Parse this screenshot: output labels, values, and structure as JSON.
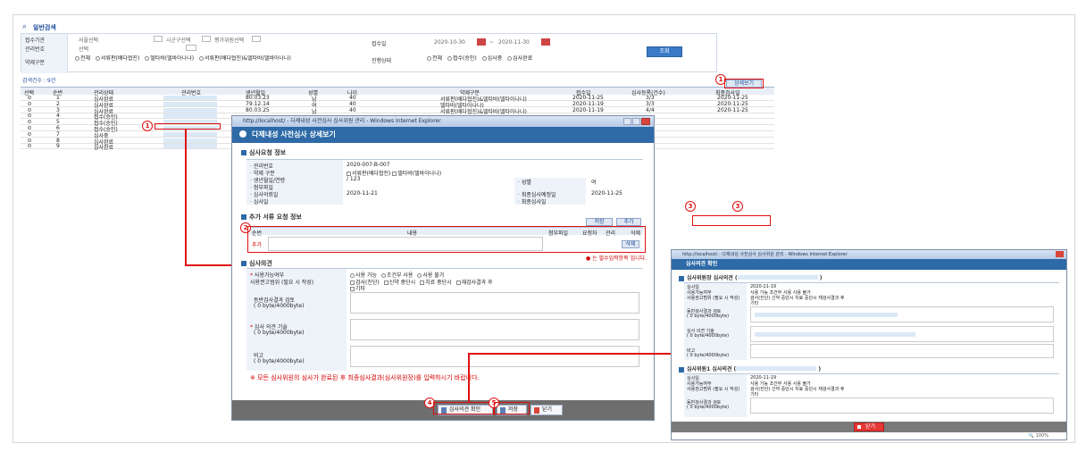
{
  "search": {
    "title": "일반검색",
    "labels": [
      "접수기관",
      "관리번호",
      "약제구분",
      "접수일",
      "진행상태"
    ],
    "org_value": "서울선택",
    "org_select2": "시군구선택",
    "org_select3": "평가위원선택",
    "mgmt_value": "선택",
    "date_from": "2020-10-30",
    "date_to": "2020-11-30",
    "drug_options": [
      "전체",
      "서류판(배다협진)",
      "델타바(델바아나나)",
      "서류판(배다협진)&델타바(델바아나나)"
    ],
    "status_options": [
      "전체",
      "접수(승인)",
      "심사중",
      "심사완료"
    ],
    "search_button": "조회"
  },
  "result": {
    "count_label": "검색건수 : 9건",
    "detail_button": "상세보기",
    "headers": [
      "선택",
      "순번",
      "관리상태",
      "관리번호",
      "생년월일",
      "성별",
      "나이",
      "약제구분",
      "접수일",
      "심사등록(건수)",
      "최종검사일"
    ],
    "rows": [
      {
        "no": "1",
        "status": "심사완료",
        "birth": "80.03.23",
        "sex": "남",
        "age": "40",
        "drug": "서류판(배다협진)&델타바(델타아나나)",
        "date": "2020-11-25",
        "cnt": "3/3",
        "last": "2020-11-25"
      },
      {
        "no": "2",
        "status": "심사완료",
        "birth": "79.12.14",
        "sex": "여",
        "age": "40",
        "drug": "델타바(델타아나나)",
        "date": "2020-11-19",
        "cnt": "3/3",
        "last": "2020-11-25"
      },
      {
        "no": "3",
        "status": "심사완료",
        "birth": "80.03.25",
        "sex": "남",
        "age": "40",
        "drug": "서류판(배다협진)&델타바(델타아나나)",
        "date": "2020-11-19",
        "cnt": "4/4",
        "last": "2020-11-25"
      },
      {
        "no": "4",
        "status": "접수(승인)"
      },
      {
        "no": "5",
        "status": "접수(승인)"
      },
      {
        "no": "6",
        "status": "접수(승인)"
      },
      {
        "no": "7",
        "status": "심사중"
      },
      {
        "no": "8",
        "status": "심사완료"
      },
      {
        "no": "9",
        "status": "심사완료"
      }
    ]
  },
  "popup": {
    "window_title": "http://localhost/ - 다제내성 사전심사 심사위원 관리 - Windows Internet Explorer",
    "header": "다제내성 사전심사 상세보기",
    "section_request": "심사요청 정보",
    "req_labels": [
      "관리번호",
      "약제 구분",
      "생년월일/연령",
      "첨부파일",
      "심사의뢰일",
      "심사일"
    ],
    "req_values": {
      "mgmt": "2020-007-B-007",
      "drug_a": "서류판(배다협진)",
      "drug_b": "델타바(델바아나나)",
      "birth": "/ 123",
      "req_date": "2020-11-21"
    },
    "req_right_labels": [
      "성별",
      "최종심사예정일",
      "최종심사일"
    ],
    "req_right_values": {
      "sex": "여",
      "final_plan": "2020-11-25"
    },
    "section_extra": "추가 서류 요청 정보",
    "extra_headers": [
      "순번",
      "내용",
      "첨부파일",
      "요청자",
      "관리",
      "삭제"
    ],
    "extra_row_label": "추가",
    "extra_delete": "삭제",
    "btn_save": "저장",
    "btn_add": "추가",
    "required_note": "는 필수입력항목 입니다.",
    "section_opinion": "심사의견",
    "op_labels": [
      "사용가능여부",
      "사용권고범위 (필요 시 작성)",
      "동반검사결과 검토",
      "심사 의견 기술",
      "비고"
    ],
    "op_use_options": [
      "사용 가능",
      "조건부 사용",
      "사용 불가"
    ],
    "op_range_options": [
      "검사(진단)",
      "신약 중단시",
      "치료 중단시",
      "재검사결과 후",
      "기타"
    ],
    "byte_note": "0 byte/4000byte)",
    "notice": "※ 모든 심사위원의 심사가 완료된 후 최종심사결과(심사위원장)를 입력하시기 바랍니다.",
    "btn_opinion": "심사의견 확인",
    "btn_save2": "저장",
    "btn_close": "닫기"
  },
  "popup2": {
    "window_title": "http://localhost/ - 다제내성 사전심사 심사위원 관리 - Windows Internet Explorer",
    "header": "심사의견 확인",
    "section1": "심사위원장 심사의견 (",
    "section2": "심사위원1 심사의견 (",
    "row_labels": [
      "심사일",
      "사용가능여부",
      "사용권고범위 (필요 시 작성)"
    ],
    "date": "2020-11-19",
    "use_opts": "사용 가능  조건부 사용  사용 불가",
    "range_opts": "검사(진단)  신약 중단시  치료 중단시  재검사결과 후",
    "etc": "기타",
    "review_label": "동반검사결과 검토",
    "opinion_label": "심사 의견 기술",
    "memo_label": "비고",
    "byte_note": "0 byte/4000byte)",
    "btn_close": "닫기",
    "zoom": "100%"
  },
  "callouts": [
    "1",
    "1",
    "2",
    "3",
    "3",
    "4",
    "5"
  ]
}
